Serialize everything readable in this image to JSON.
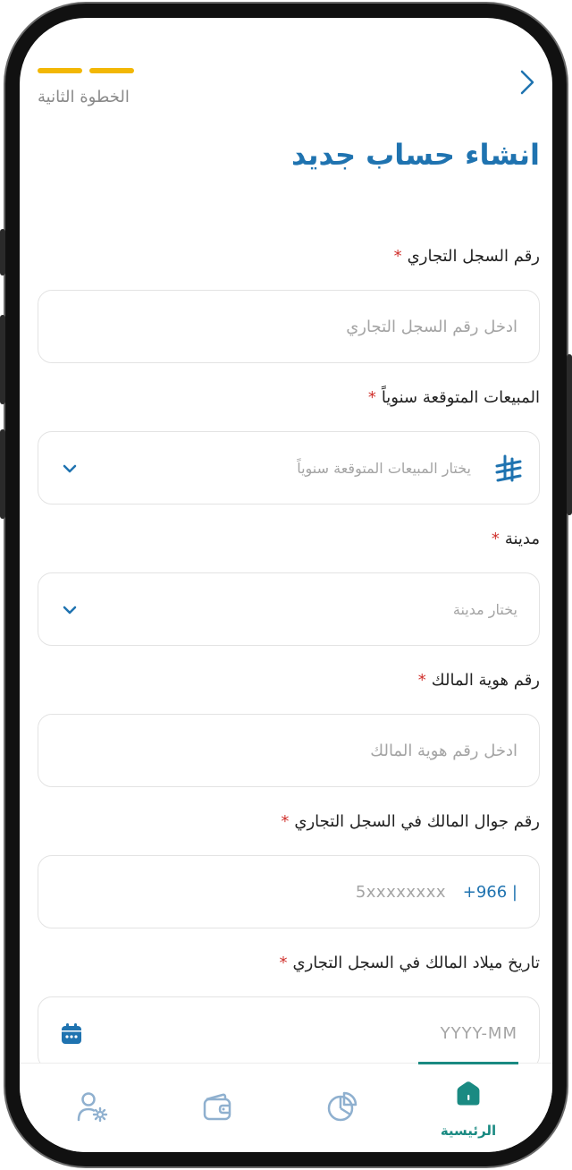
{
  "header": {
    "step_label": "الخطوة الثانية",
    "title": "انشاء حساب جديد",
    "back_icon": "chevron-right-icon"
  },
  "progress": {
    "current_step": 2,
    "total_steps": 2
  },
  "form": {
    "cr_number": {
      "label": "رقم السجل التجاري",
      "required_mark": "*",
      "placeholder": "ادخل رقم السجل التجاري"
    },
    "annual_sales": {
      "label": "المبيعات المتوقعة سنوياً",
      "required_mark": "*",
      "placeholder": "يختار المبيعات المتوقعة سنوياً",
      "icon": "riyal-icon"
    },
    "city": {
      "label": "مدينة",
      "required_mark": "*",
      "placeholder": "يختار مدينة"
    },
    "owner_id": {
      "label": "رقم هوية المالك",
      "required_mark": "*",
      "placeholder": "ادخل رقم هوية المالك"
    },
    "owner_mobile": {
      "label": "رقم جوال المالك في السجل التجاري",
      "required_mark": "*",
      "prefix": "+966 |",
      "placeholder": "5xxxxxxxx"
    },
    "owner_birthdate": {
      "label": "تاريخ ميلاد المالك في السجل التجاري",
      "required_mark": "*",
      "placeholder": "YYYY-MM"
    }
  },
  "bottom_nav": {
    "items": [
      {
        "label": "الرئيسية",
        "icon": "home-icon",
        "active": true
      },
      {
        "label": "",
        "icon": "pie-chart-icon",
        "active": false
      },
      {
        "label": "",
        "icon": "wallet-icon",
        "active": false
      },
      {
        "label": "",
        "icon": "user-settings-icon",
        "active": false
      }
    ]
  },
  "colors": {
    "primary": "#1f73b0",
    "accent_step": "#f2b705",
    "required": "#d0312d",
    "nav_active": "#1a8a82",
    "nav_icon": "#8fb0cf"
  }
}
